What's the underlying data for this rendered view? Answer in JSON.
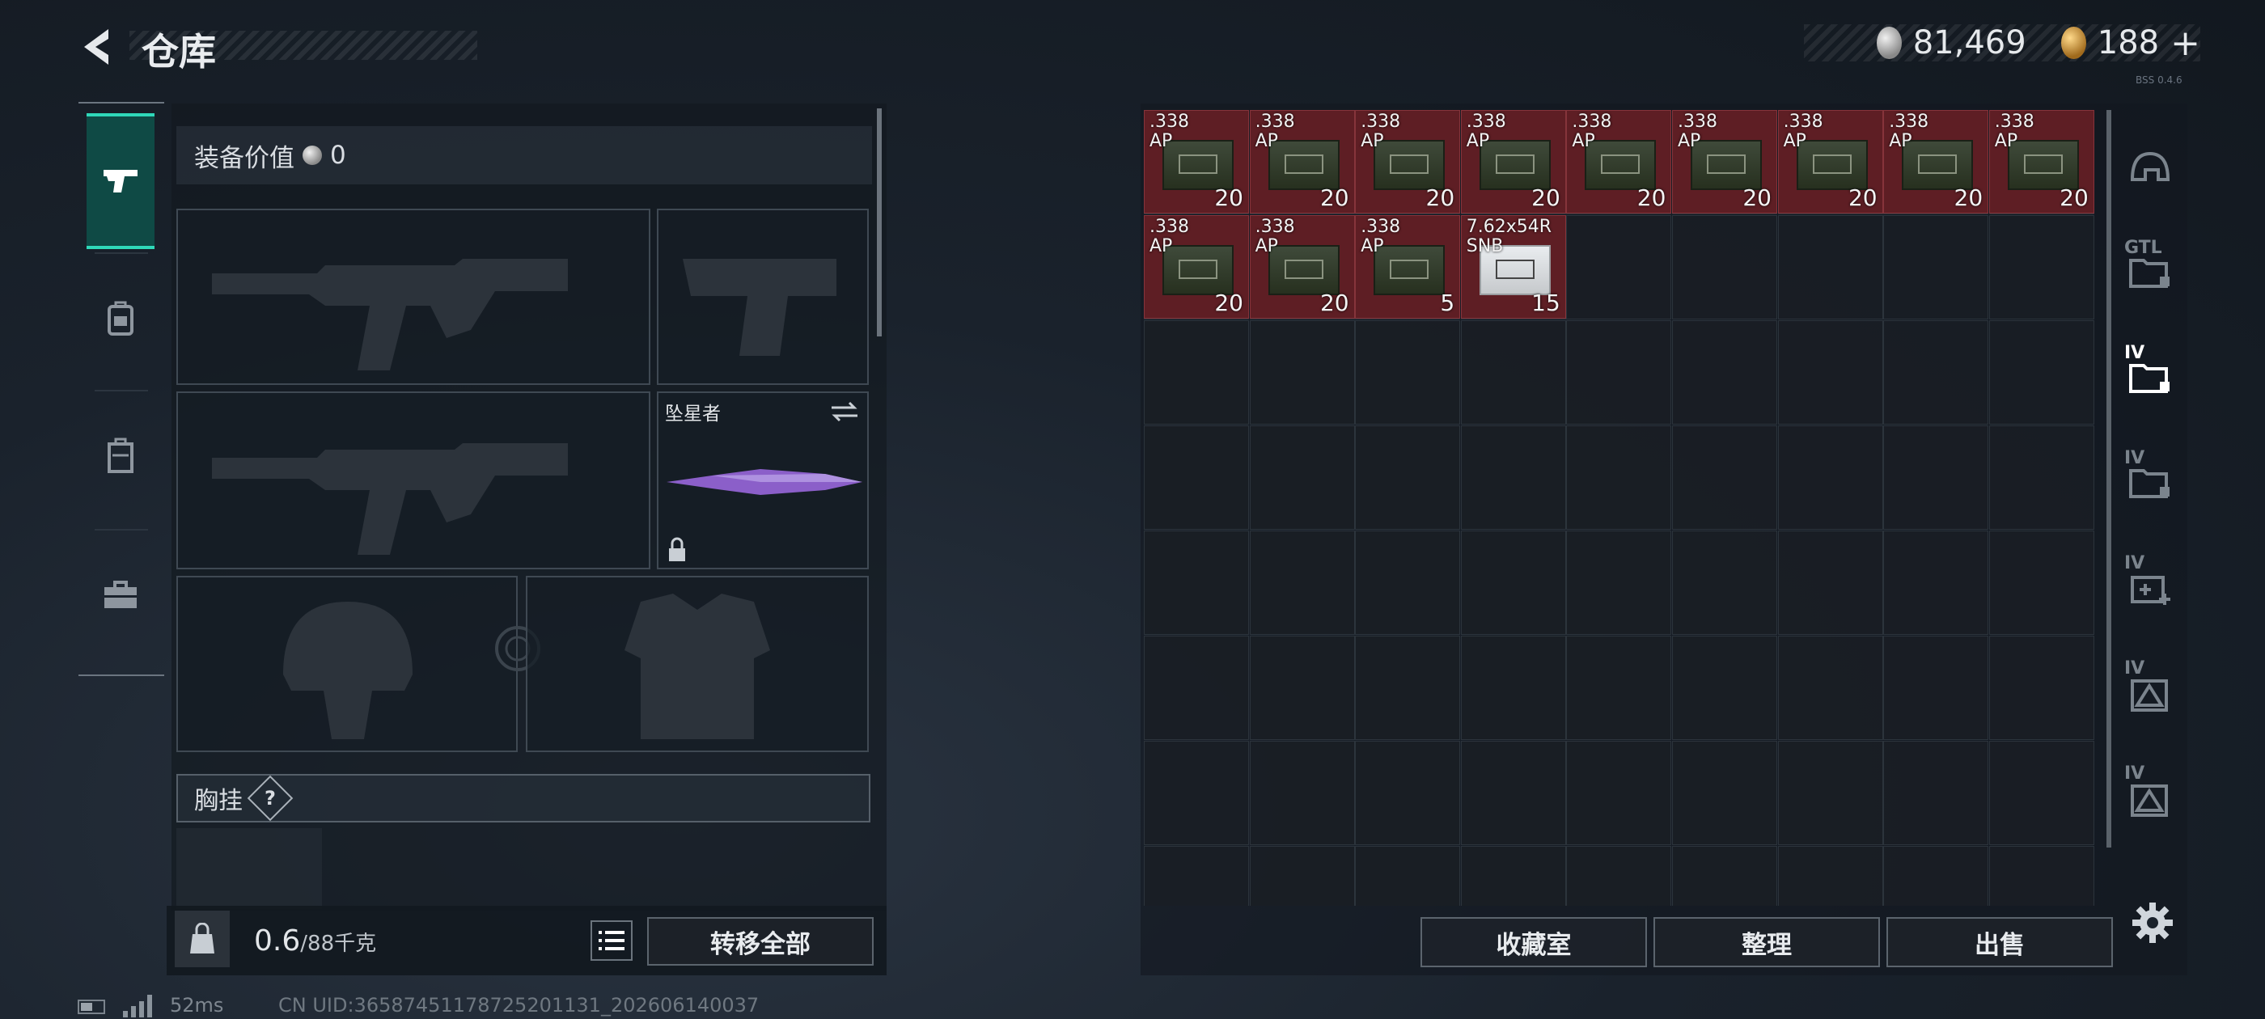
{
  "header": {
    "title": "仓库",
    "currency_silver": "81,469",
    "currency_gold": "188",
    "currency_add": "+",
    "build": "BSS 0.4.6"
  },
  "left_nav": {
    "tabs": [
      "pistol-icon",
      "backpack-icon",
      "storage-case-icon",
      "toolbox-icon"
    ],
    "active": 0
  },
  "equipment": {
    "value_label": "装备价值",
    "value": "0",
    "melee_name": "坠星者",
    "vest_label": "胸挂",
    "vest_help": "?"
  },
  "bottom_left": {
    "weight_current": "0.6",
    "weight_max": "/88千克",
    "transfer_all": "转移全部"
  },
  "inventory": {
    "items": [
      {
        "row": 0,
        "col": 0,
        "label": ".338\nAP",
        "count": "20",
        "kind": "ammo"
      },
      {
        "row": 0,
        "col": 1,
        "label": ".338\nAP",
        "count": "20",
        "kind": "ammo"
      },
      {
        "row": 0,
        "col": 2,
        "label": ".338\nAP",
        "count": "20",
        "kind": "ammo"
      },
      {
        "row": 0,
        "col": 3,
        "label": ".338\nAP",
        "count": "20",
        "kind": "ammo"
      },
      {
        "row": 0,
        "col": 4,
        "label": ".338\nAP",
        "count": "20",
        "kind": "ammo"
      },
      {
        "row": 0,
        "col": 5,
        "label": ".338\nAP",
        "count": "20",
        "kind": "ammo"
      },
      {
        "row": 0,
        "col": 6,
        "label": ".338\nAP",
        "count": "20",
        "kind": "ammo"
      },
      {
        "row": 0,
        "col": 7,
        "label": ".338\nAP",
        "count": "20",
        "kind": "ammo"
      },
      {
        "row": 0,
        "col": 8,
        "label": ".338\nAP",
        "count": "20",
        "kind": "ammo"
      },
      {
        "row": 1,
        "col": 0,
        "label": ".338\nAP",
        "count": "20",
        "kind": "ammo"
      },
      {
        "row": 1,
        "col": 1,
        "label": ".338\nAP",
        "count": "20",
        "kind": "ammo"
      },
      {
        "row": 1,
        "col": 2,
        "label": ".338\nAP",
        "count": "5",
        "kind": "ammo"
      },
      {
        "row": 1,
        "col": 3,
        "label": "7.62x54R\nSNB",
        "count": "15",
        "kind": "ammo-white"
      }
    ],
    "grid_cols": 9,
    "grid_rows": 8
  },
  "bottom_right": {
    "collection": "收藏室",
    "sort": "整理",
    "sell": "出售"
  },
  "right_tabs": [
    {
      "icon": "helmet-icon",
      "label": ""
    },
    {
      "icon": "gtl-folder-icon",
      "label": "GTL"
    },
    {
      "icon": "folder-iv-icon",
      "label": "IV"
    },
    {
      "icon": "folder-iv-icon",
      "label": "IV"
    },
    {
      "icon": "medkit-iv-icon",
      "label": "IV"
    },
    {
      "icon": "warning-iv-icon",
      "label": "IV"
    },
    {
      "icon": "warning-iv-icon",
      "label": "IV"
    }
  ],
  "status": {
    "ping": "52ms",
    "uid": "CN UID:36587451178725201131_202606140037"
  },
  "colors": {
    "accent": "#2fd8b9",
    "item_bg": "#5e1e24"
  }
}
